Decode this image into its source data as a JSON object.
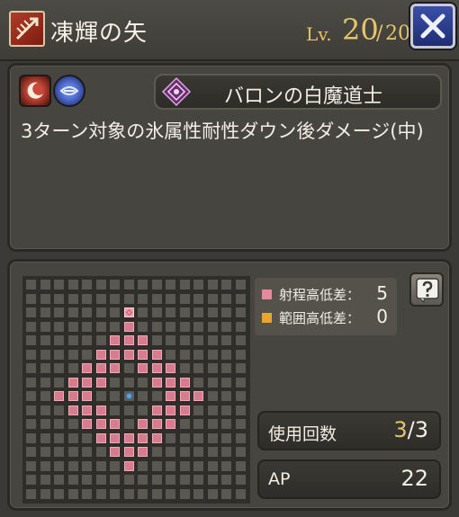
{
  "header": {
    "skill_type_icon": "bow-arrow-icon",
    "skill_name": "凍輝の矢",
    "level_prefix": "Lv.",
    "level_current": "20",
    "level_separator": "/",
    "level_max": "20",
    "close_icon": "close-x-icon"
  },
  "details": {
    "element_icons": [
      "moon-icon",
      "ice-orb-icon"
    ],
    "job_icon": "white-mage-emblem-icon",
    "job_name": "バロンの白魔道士",
    "description": "3ターン対象の氷属性耐性ダウン後ダメージ(中)"
  },
  "range": {
    "legend": [
      {
        "label": "射程高低差：",
        "value": "5",
        "color": "#e38a9c"
      },
      {
        "label": "範囲高低差：",
        "value": "0",
        "color": "#e6a62f"
      }
    ],
    "help_icon": "question-mark-icon",
    "colors": {
      "hit": "#d97b8e",
      "empty": "#5a5852",
      "center": "#4aa8ff",
      "target": "#e4475a"
    }
  },
  "stats": {
    "uses_label": "使用回数",
    "uses_current": "3",
    "uses_separator": "/",
    "uses_max": "3",
    "ap_label": "AP",
    "ap_value": "22"
  }
}
